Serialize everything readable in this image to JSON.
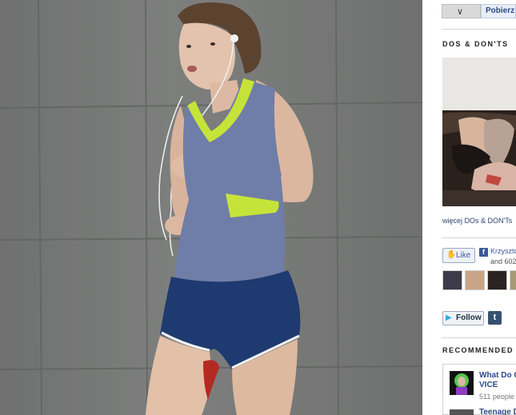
{
  "photo": {
    "alt_subject": "runner"
  },
  "topbar": {
    "dropdown_icon": "chevron-down-icon",
    "download_label": "Pobierz"
  },
  "dos_donts": {
    "heading": "DOS & DON'TS",
    "more_link": "więcej DOs & DON'Ts"
  },
  "facebook": {
    "like_label": "Like",
    "friend_name": "Krzysztof",
    "others_text": "and 602"
  },
  "social": {
    "follow_label": "Follow",
    "tumblr_glyph": "t"
  },
  "recommended": {
    "heading": "RECOMMENDED",
    "items": [
      {
        "title": "What Do C",
        "source": "VICE",
        "meta": "511 people"
      },
      {
        "title": "Teenage D"
      }
    ]
  },
  "colors": {
    "link": "#2c4a86",
    "facebook": "#3b5998",
    "twitter": "#35a8e0"
  }
}
